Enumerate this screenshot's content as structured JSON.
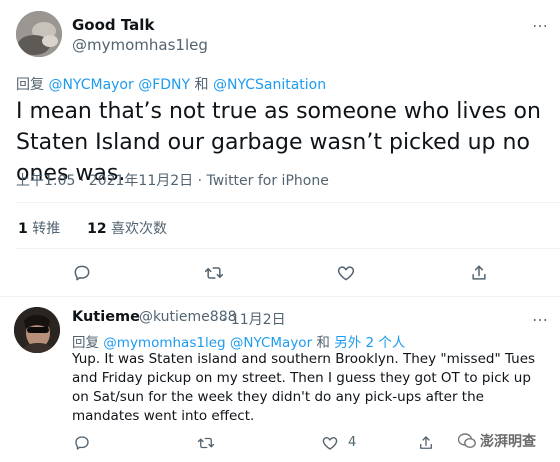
{
  "tweet": {
    "author_name": "Good Talk",
    "author_handle": "@mymomhas1leg",
    "reply_prefix": "回复",
    "reply_mentions": "@NYCMayor @FDNY",
    "reply_and": "和",
    "reply_mention_last": "@NYCSanitation",
    "text": "I mean that’s not true as someone who lives on Staten Island our garbage wasn’t picked up no ones was.",
    "timestamp": "上午1:05 · 2021年11月2日 · Twitter for iPhone",
    "retweets_count": "1",
    "retweets_label": "转推",
    "likes_count": "12",
    "likes_label": "喜欢次数"
  },
  "reply": {
    "author_name": "Kutieme",
    "author_handle": "@kutieme888",
    "date": "· 11月2日",
    "reply_prefix": "回复",
    "reply_mentions": "@mymomhas1leg @NYCMayor",
    "reply_and": "和",
    "reply_others": "另外 2 个人",
    "text": "Yup. It was Staten island and southern Brooklyn. They \"missed\"  Tues and Friday pickup on my street. Then I guess they got OT to pick up on Sat/sun for the week they didn't do any pick-ups after the mandates went into effect.",
    "like_count": "4"
  },
  "icons": {
    "reply": "reply-icon",
    "retweet": "retweet-icon",
    "like": "heart-icon",
    "share": "share-icon",
    "more": "more-icon"
  },
  "watermark": {
    "text": "澎湃明查"
  }
}
